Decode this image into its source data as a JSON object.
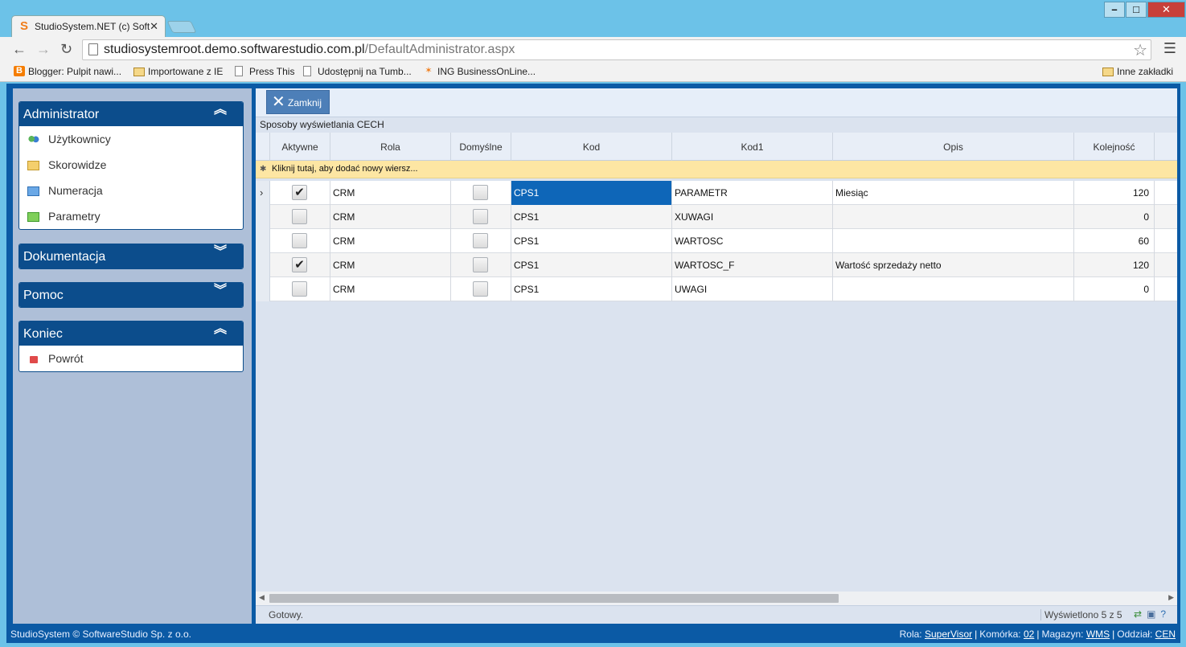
{
  "browser": {
    "tab_title": "StudioSystem.NET (c) Soft",
    "url_host": "studiosystemroot.demo.softwarestudio.com.pl",
    "url_path": "/DefaultAdministrator.aspx",
    "bookmarks": [
      {
        "label": "Blogger: Pulpit nawi...",
        "icon": "blogger-icon"
      },
      {
        "label": "Importowane z IE",
        "icon": "folder-icon"
      },
      {
        "label": "Press This",
        "icon": "page-icon"
      },
      {
        "label": "Udostępnij na Tumb...",
        "icon": "page-icon"
      },
      {
        "label": "ING BusinessOnLine...",
        "icon": "ing-icon"
      }
    ],
    "other_bookmarks": "Inne zakładki"
  },
  "sidebar": {
    "admin": {
      "title": "Administrator",
      "items": [
        {
          "label": "Użytkownicy",
          "icon": "users-icon"
        },
        {
          "label": "Skorowidze",
          "icon": "folder-yellow-icon"
        },
        {
          "label": "Numeracja",
          "icon": "folder-blue-icon"
        },
        {
          "label": "Parametry",
          "icon": "folder-green-icon"
        }
      ]
    },
    "docs": {
      "title": "Dokumentacja"
    },
    "help": {
      "title": "Pomoc"
    },
    "end": {
      "title": "Koniec",
      "items": [
        {
          "label": "Powrót",
          "icon": "return-icon"
        }
      ]
    }
  },
  "toolbar": {
    "close_label": "Zamknij"
  },
  "grid": {
    "title": "Sposoby wyświetlania CECH",
    "columns": [
      "Aktywne",
      "Rola",
      "Domyślne",
      "Kod",
      "Kod1",
      "Opis",
      "Kolejność"
    ],
    "new_row_text": "Kliknij tutaj, aby dodać nowy wiersz...",
    "rows": [
      {
        "aktywne": true,
        "rola": "CRM",
        "domyslne": false,
        "kod": "CPS1",
        "kod1": "PARAMETR",
        "opis": "Miesiąc",
        "kolejnosc": "120"
      },
      {
        "aktywne": false,
        "rola": "CRM",
        "domyslne": false,
        "kod": "CPS1",
        "kod1": "XUWAGI",
        "opis": "",
        "kolejnosc": "0"
      },
      {
        "aktywne": false,
        "rola": "CRM",
        "domyslne": false,
        "kod": "CPS1",
        "kod1": "WARTOSC",
        "opis": "",
        "kolejnosc": "60"
      },
      {
        "aktywne": true,
        "rola": "CRM",
        "domyslne": false,
        "kod": "CPS1",
        "kod1": "WARTOSC_F",
        "opis": "Wartość sprzedaży netto",
        "kolejnosc": "120"
      },
      {
        "aktywne": false,
        "rola": "CRM",
        "domyslne": false,
        "kod": "CPS1",
        "kod1": "UWAGI",
        "opis": "",
        "kolejnosc": "0"
      }
    ]
  },
  "status": {
    "ready": "Gotowy.",
    "count": "Wyświetlono 5 z 5"
  },
  "footer": {
    "copyright": "StudioSystem © SoftwareStudio Sp. z o.o.",
    "rola_label": "Rola:",
    "rola_value": "SuperVisor",
    "komorka_label": "Komórka:",
    "komorka_value": "02",
    "magazyn_label": "Magazyn:",
    "magazyn_value": "WMS",
    "oddzial_label": "Oddział:",
    "oddzial_value": "CEN"
  }
}
